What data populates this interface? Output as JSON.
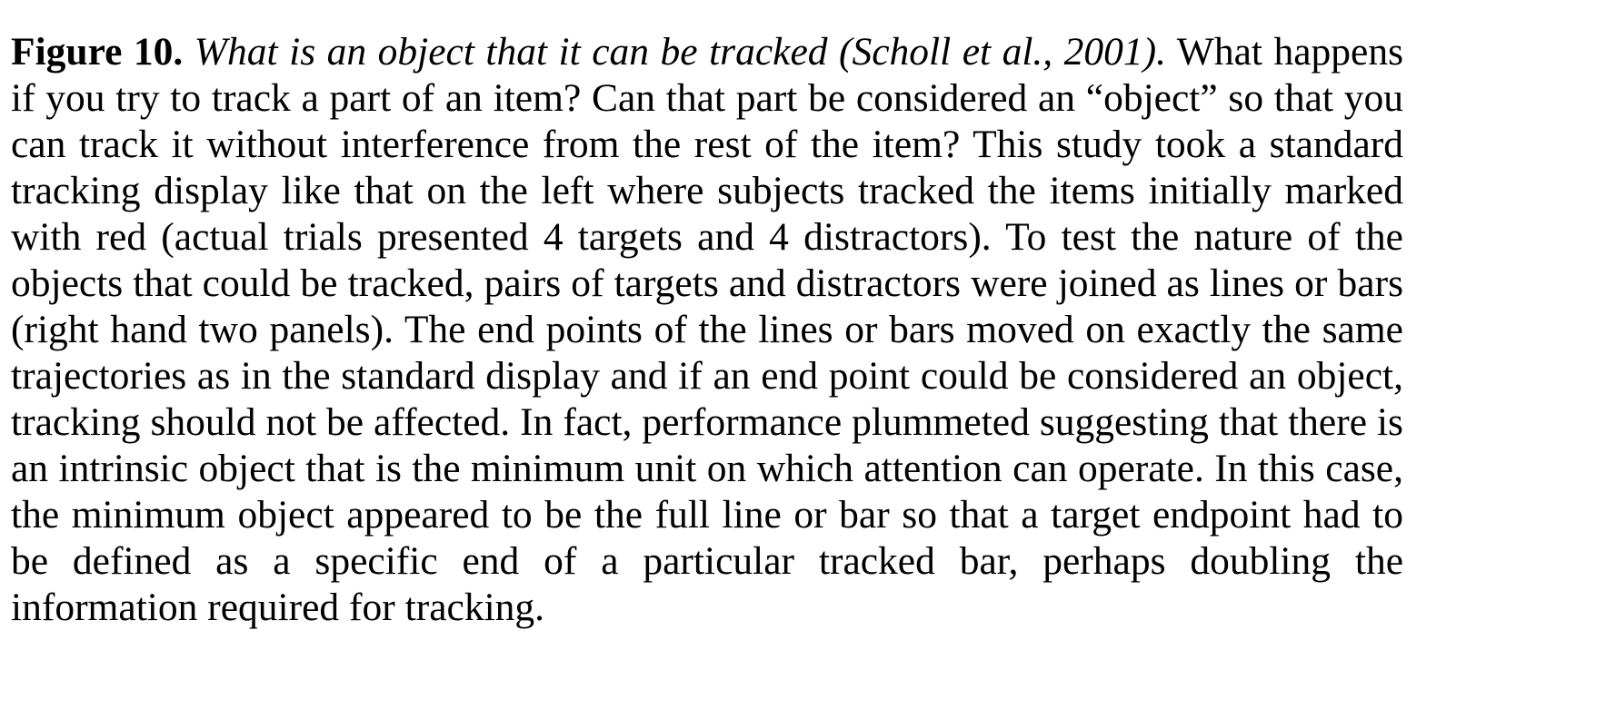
{
  "caption": {
    "label": "Figure 10.",
    "title": "What is an object that it can be tracked (Scholl et al., 2001).",
    "body": "What happens if you try to track a part of an item? Can that part be considered an “object” so that you can track it without interference from the rest of the item? This study took a standard tracking display like that on the left where subjects tracked the items initially marked with red (actual trials presented 4 targets and 4 distractors). To test the nature of the objects that could be tracked, pairs of targets and distractors were joined as lines or bars (right hand two panels). The end points of the lines or bars moved on exactly the same trajectories as in the standard display and if an end point could be considered an object, tracking should not be affected. In fact, performance plummeted suggesting that there is an intrinsic object that is the minimum unit on which attention can operate. In this case, the minimum object appeared to be the full line or bar so that a target endpoint had to be defined as a specific end of a particular tracked bar, perhaps doubling the information required for tracking."
  }
}
